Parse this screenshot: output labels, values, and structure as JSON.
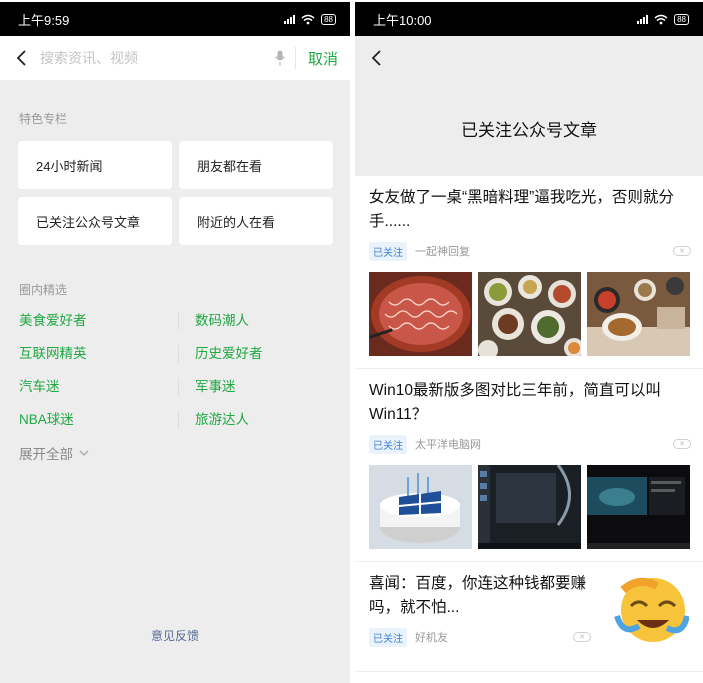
{
  "left": {
    "status_time": "上午9:59",
    "battery": "88",
    "search": {
      "placeholder": "搜索资讯、视频",
      "cancel_label": "取消"
    },
    "featured": {
      "title": "特色专栏",
      "items": [
        "24小时新闻",
        "朋友都在看",
        "已关注公众号文章",
        "附近的人在看"
      ]
    },
    "circle": {
      "title": "圈内精选",
      "items": [
        "美食爱好者",
        "数码潮人",
        "互联网精英",
        "历史爱好者",
        "汽车迷",
        "军事迷",
        "NBA球迷",
        "旅游达人"
      ],
      "expand_label": "展开全部"
    },
    "feedback_label": "意见反馈"
  },
  "right": {
    "status_time": "上午10:00",
    "battery": "88",
    "page_title": "已关注公众号文章",
    "articles": [
      {
        "title": "女友做了一桌“黑暗料理”逼我吃光，否则就分手......",
        "tag": "已关注",
        "source": "一起神回复"
      },
      {
        "title": "Win10最新版多图对比三年前，简直可以叫Win11？",
        "tag": "已关注",
        "source": "太平洋电脑网"
      },
      {
        "title": "喜闻：百度，你连这种钱都要赚吗，就不怕...",
        "tag": "已关注",
        "source": "好机友"
      }
    ]
  },
  "colors": {
    "accent_green": "#20a843",
    "link_blue": "#576b95",
    "tag_blue": "#3d7fd1"
  }
}
